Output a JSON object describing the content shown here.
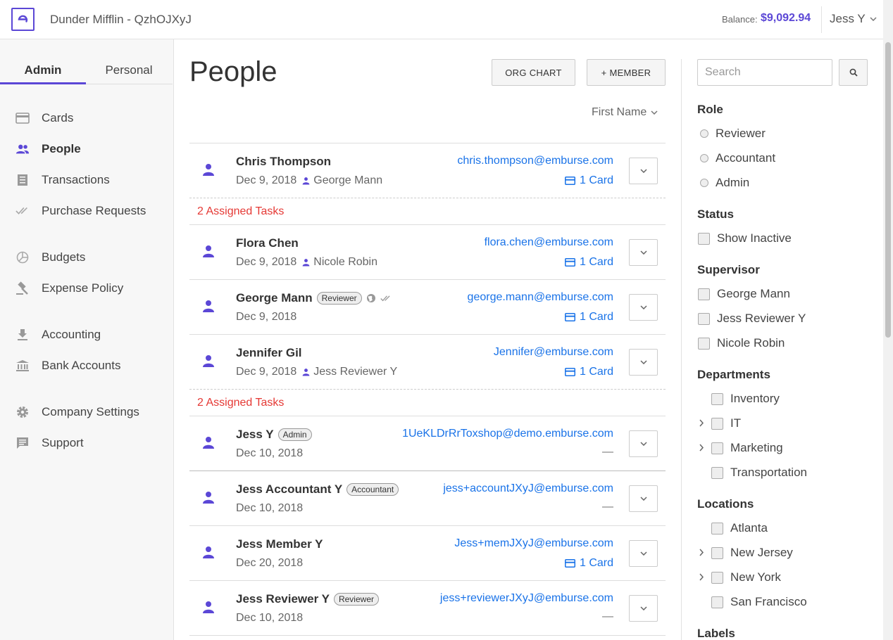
{
  "header": {
    "company": "Dunder Mifflin - QzhOJXyJ",
    "balance_label": "Balance:",
    "balance_value": "$9,092.94",
    "user": "Jess Y"
  },
  "sidebar": {
    "tabs": [
      {
        "label": "Admin"
      },
      {
        "label": "Personal"
      }
    ],
    "items": [
      {
        "label": "Cards",
        "icon": "card-icon"
      },
      {
        "label": "People",
        "icon": "people-icon"
      },
      {
        "label": "Transactions",
        "icon": "receipt-icon"
      },
      {
        "label": "Purchase Requests",
        "icon": "double-check-icon"
      },
      {
        "label": "Budgets",
        "icon": "pie-chart-icon"
      },
      {
        "label": "Expense Policy",
        "icon": "gavel-icon"
      },
      {
        "label": "Accounting",
        "icon": "download-icon"
      },
      {
        "label": "Bank Accounts",
        "icon": "bank-icon"
      },
      {
        "label": "Company Settings",
        "icon": "gear-icon"
      },
      {
        "label": "Support",
        "icon": "chat-icon"
      }
    ]
  },
  "main": {
    "title": "People",
    "org_chart_label": "ORG CHART",
    "add_member_label": "+ MEMBER",
    "sort_label": "First Name",
    "tasks_label": "2 Assigned Tasks",
    "people": [
      {
        "name": "Chris Thompson",
        "date": "Dec 9, 2018",
        "supervisor": "George Mann",
        "email": "chris.thompson@emburse.com",
        "cards": "1 Card"
      },
      {
        "name": "Flora Chen",
        "date": "Dec 9, 2018",
        "supervisor": "Nicole Robin",
        "email": "flora.chen@emburse.com",
        "cards": "1 Card"
      },
      {
        "name": "George Mann",
        "badge": "Reviewer",
        "date": "Dec 9, 2018",
        "email": "george.mann@emburse.com",
        "cards": "1 Card"
      },
      {
        "name": "Jennifer Gil",
        "date": "Dec 9, 2018",
        "supervisor": "Jess Reviewer Y",
        "email": "Jennifer@emburse.com",
        "cards": "1 Card"
      },
      {
        "name": "Jess Y",
        "badge": "Admin",
        "date": "Dec 10, 2018",
        "email": "1UeKLDrRrToxshop@demo.emburse.com",
        "cards": "—"
      },
      {
        "name": "Jess Accountant Y",
        "badge": "Accountant",
        "date": "Dec 10, 2018",
        "email": "jess+accountJXyJ@emburse.com",
        "cards": "—"
      },
      {
        "name": "Jess Member Y",
        "date": "Dec 20, 2018",
        "email": "Jess+memJXyJ@emburse.com",
        "cards": "1 Card"
      },
      {
        "name": "Jess Reviewer Y",
        "badge": "Reviewer",
        "date": "Dec 10, 2018",
        "email": "jess+reviewerJXyJ@emburse.com",
        "cards": "—"
      }
    ]
  },
  "filters": {
    "search_placeholder": "Search",
    "role": {
      "heading": "Role",
      "options": [
        "Reviewer",
        "Accountant",
        "Admin"
      ]
    },
    "status": {
      "heading": "Status",
      "options": [
        "Show Inactive"
      ]
    },
    "supervisor": {
      "heading": "Supervisor",
      "options": [
        "George Mann",
        "Jess Reviewer Y",
        "Nicole Robin"
      ]
    },
    "departments": {
      "heading": "Departments",
      "options": [
        "Inventory",
        "IT",
        "Marketing",
        "Transportation"
      ]
    },
    "locations": {
      "heading": "Locations",
      "options": [
        "Atlanta",
        "New Jersey",
        "New York",
        "San Francisco"
      ]
    },
    "labels": {
      "heading": "Labels"
    }
  },
  "colors": {
    "accent": "#5b47d6",
    "link": "#1a73e8",
    "alert": "#e53935"
  }
}
